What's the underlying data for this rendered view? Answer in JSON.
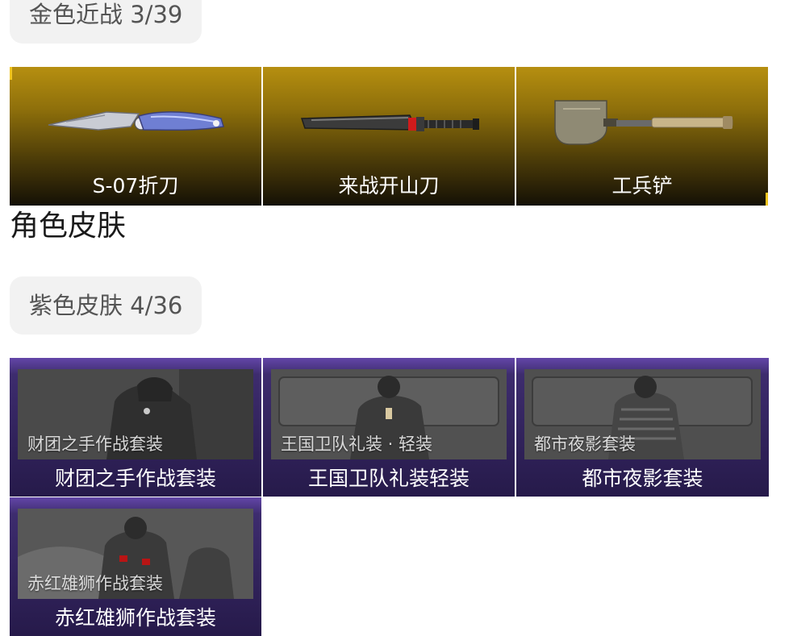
{
  "gold_melee": {
    "title": "金色近战 3/39",
    "items": [
      {
        "label": "S-07折刀",
        "icon": "folding-knife-icon"
      },
      {
        "label": "来战开山刀",
        "icon": "machete-icon"
      },
      {
        "label": "工兵铲",
        "icon": "shovel-icon"
      }
    ]
  },
  "character_skins": {
    "heading": "角色皮肤",
    "purple_skins": {
      "title": "紫色皮肤 4/36",
      "items": [
        {
          "caption": "财团之手作战套装",
          "label": "财团之手作战套装"
        },
        {
          "caption": "王国卫队礼装 · 轻装",
          "label": "王国卫队礼装轻装"
        },
        {
          "caption": "都市夜影套装",
          "label": "都市夜影套装"
        },
        {
          "caption": "赤红雄狮作战套装",
          "label": "赤红雄狮作战套装"
        }
      ]
    }
  },
  "colors": {
    "gold_accent": "#f0c41e",
    "purple_accent": "#6346a8"
  }
}
